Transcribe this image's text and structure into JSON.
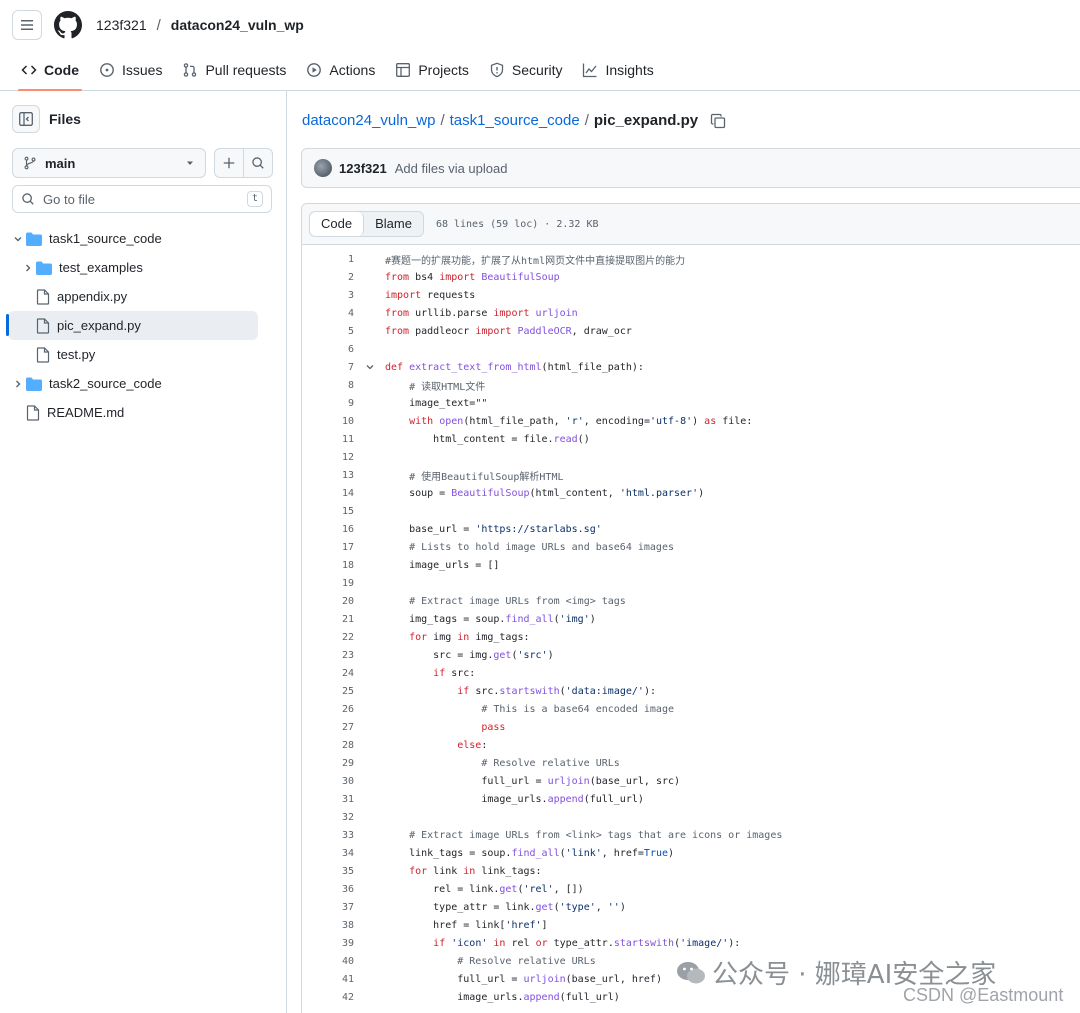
{
  "header": {
    "owner": "123f321",
    "separator": "/",
    "repo": "datacon24_vuln_wp"
  },
  "tabs": [
    {
      "label": "Code",
      "icon": "code-icon"
    },
    {
      "label": "Issues",
      "icon": "issue-icon"
    },
    {
      "label": "Pull requests",
      "icon": "pull-request-icon"
    },
    {
      "label": "Actions",
      "icon": "play-icon"
    },
    {
      "label": "Projects",
      "icon": "table-icon"
    },
    {
      "label": "Security",
      "icon": "shield-icon"
    },
    {
      "label": "Insights",
      "icon": "graph-icon"
    }
  ],
  "sidebar": {
    "title": "Files",
    "branch": "main",
    "search_placeholder": "Go to file",
    "search_shortcut": "t",
    "tree": [
      {
        "label": "task1_source_code",
        "type": "folder",
        "expanded": true
      },
      {
        "label": "test_examples",
        "type": "folder",
        "expanded": false
      },
      {
        "label": "appendix.py",
        "type": "file"
      },
      {
        "label": "pic_expand.py",
        "type": "file",
        "selected": true
      },
      {
        "label": "test.py",
        "type": "file"
      },
      {
        "label": "task2_source_code",
        "type": "folder",
        "expanded": false
      },
      {
        "label": "README.md",
        "type": "file"
      }
    ]
  },
  "breadcrumb": {
    "repo": "datacon24_vuln_wp",
    "folder": "task1_source_code",
    "sep": "/",
    "file": "pic_expand.py"
  },
  "commit": {
    "user": "123f321",
    "message": "Add files via upload"
  },
  "viewer": {
    "code_label": "Code",
    "blame_label": "Blame",
    "meta": "68 lines (59 loc) · 2.32 KB"
  },
  "code_lines": [
    {
      "n": "1",
      "t": "#赛题一的扩展功能，扩展了从html网页文件中直接提取图片的能力"
    },
    {
      "n": "2",
      "t": "from bs4 import BeautifulSoup"
    },
    {
      "n": "3",
      "t": "import requests"
    },
    {
      "n": "4",
      "t": "from urllib.parse import urljoin"
    },
    {
      "n": "5",
      "t": "from paddleocr import PaddleOCR, draw_ocr"
    },
    {
      "n": "6",
      "t": ""
    },
    {
      "n": "7",
      "t": "def extract_text_from_html(html_file_path):"
    },
    {
      "n": "8",
      "t": "    # 读取HTML文件"
    },
    {
      "n": "9",
      "t": "    image_text=\"\""
    },
    {
      "n": "10",
      "t": "    with open(html_file_path, 'r', encoding='utf-8') as file:"
    },
    {
      "n": "11",
      "t": "        html_content = file.read()"
    },
    {
      "n": "12",
      "t": ""
    },
    {
      "n": "13",
      "t": "    # 使用BeautifulSoup解析HTML"
    },
    {
      "n": "14",
      "t": "    soup = BeautifulSoup(html_content, 'html.parser')"
    },
    {
      "n": "15",
      "t": ""
    },
    {
      "n": "16",
      "t": "    base_url = 'https://starlabs.sg'"
    },
    {
      "n": "17",
      "t": "    # Lists to hold image URLs and base64 images"
    },
    {
      "n": "18",
      "t": "    image_urls = []"
    },
    {
      "n": "19",
      "t": ""
    },
    {
      "n": "20",
      "t": "    # Extract image URLs from <img> tags"
    },
    {
      "n": "21",
      "t": "    img_tags = soup.find_all('img')"
    },
    {
      "n": "22",
      "t": "    for img in img_tags:"
    },
    {
      "n": "23",
      "t": "        src = img.get('src')"
    },
    {
      "n": "24",
      "t": "        if src:"
    },
    {
      "n": "25",
      "t": "            if src.startswith('data:image/'):"
    },
    {
      "n": "26",
      "t": "                # This is a base64 encoded image"
    },
    {
      "n": "27",
      "t": "                pass"
    },
    {
      "n": "28",
      "t": "            else:"
    },
    {
      "n": "29",
      "t": "                # Resolve relative URLs"
    },
    {
      "n": "30",
      "t": "                full_url = urljoin(base_url, src)"
    },
    {
      "n": "31",
      "t": "                image_urls.append(full_url)"
    },
    {
      "n": "32",
      "t": ""
    },
    {
      "n": "33",
      "t": "    # Extract image URLs from <link> tags that are icons or images"
    },
    {
      "n": "34",
      "t": "    link_tags = soup.find_all('link', href=True)"
    },
    {
      "n": "35",
      "t": "    for link in link_tags:"
    },
    {
      "n": "36",
      "t": "        rel = link.get('rel', [])"
    },
    {
      "n": "37",
      "t": "        type_attr = link.get('type', '')"
    },
    {
      "n": "38",
      "t": "        href = link['href']"
    },
    {
      "n": "39",
      "t": "        if 'icon' in rel or type_attr.startswith('image/'):"
    },
    {
      "n": "40",
      "t": "            # Resolve relative URLs"
    },
    {
      "n": "41",
      "t": "            full_url = urljoin(base_url, href)"
    },
    {
      "n": "42",
      "t": "            image_urls.append(full_url)"
    }
  ],
  "watermark": {
    "wechat": "公众号 · 娜璋AI安全之家",
    "csdn": "CSDN @Eastmount"
  },
  "colors": {
    "accent": "#0969da",
    "tab_underline": "#fd8c73",
    "keyword": "#cf222e",
    "function": "#8250df",
    "string": "#0a3069"
  }
}
